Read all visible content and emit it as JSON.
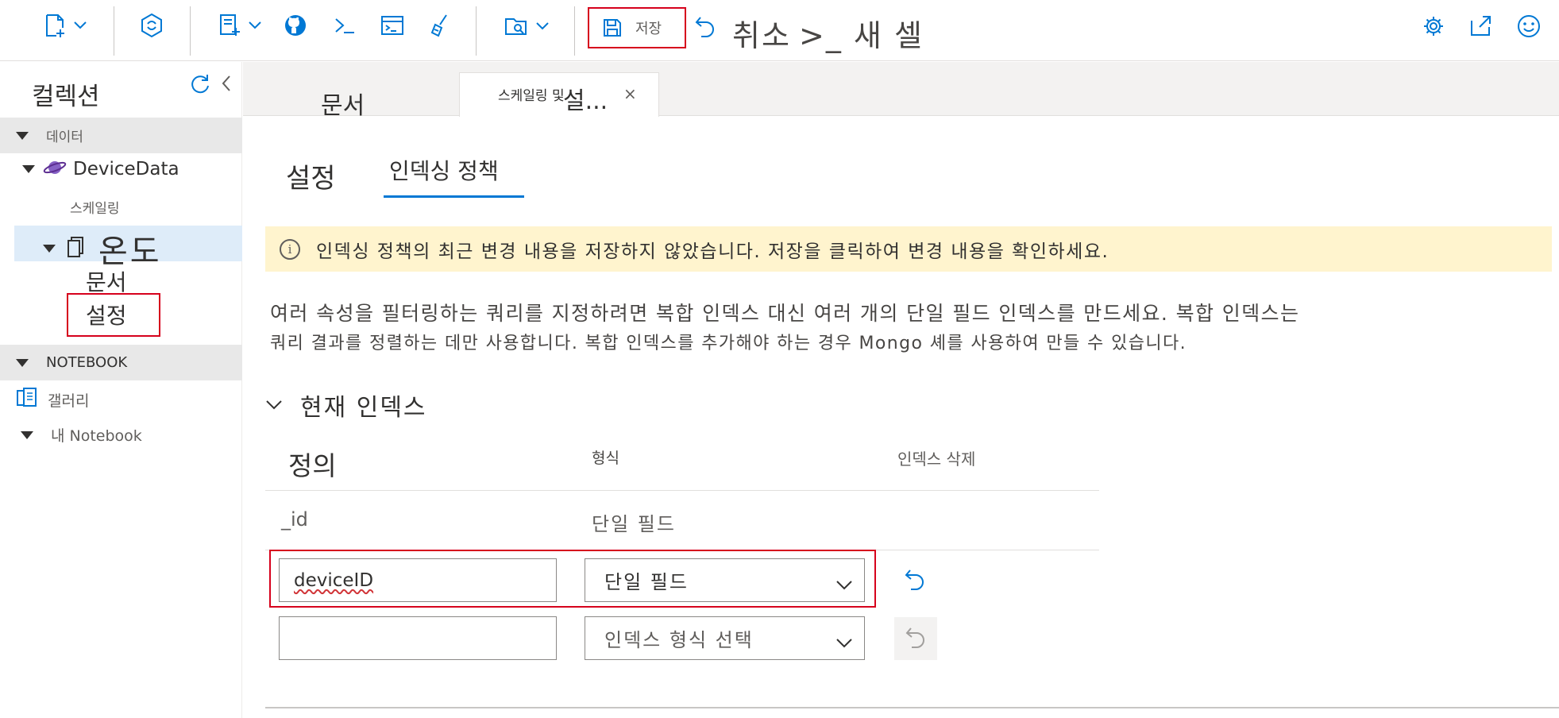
{
  "toolbar": {
    "save_label": "저장",
    "cancel_label": "취소",
    "new_cell_label": ">_ 새 셀"
  },
  "sidebar": {
    "title": "컬렉션",
    "data_section": "데이터",
    "database": "DeviceData",
    "scaling": "스케일링",
    "collection": "온도",
    "documents": "문서",
    "settings": "설정",
    "notebook_section": "NOTEBOOK",
    "gallery": "갤러리",
    "my_notebook": "내 Notebook"
  },
  "tabs": {
    "documents": "문서",
    "active_small": "스케일링 및",
    "active_big": "설...",
    "close": "×"
  },
  "subtabs": {
    "settings": "설정",
    "indexing_policy": "인덱싱 정책"
  },
  "banner": {
    "icon": "info-icon",
    "glyph": "i",
    "message": "인덱싱 정책의 최근 변경 내용을 저장하지 않았습니다. 저장을 클릭하여 변경 내용을 확인하세요."
  },
  "description": {
    "line1": "여러 속성을 필터링하는 쿼리를 지정하려면 복합 인덱스 대신 여러 개의 단일 필드 인덱스를 만드세요. 복합 인덱스는",
    "line2": "쿼리 결과를 정렬하는 데만 사용합니다. 복합 인덱스를 추가해야 하는 경우 Mongo 셰를 사용하여 만들 수 있습니다."
  },
  "indexes": {
    "section_title": "현재 인덱스",
    "col_definition": "정의",
    "col_type": "형식",
    "col_delete": "인덱스 삭제",
    "rows": [
      {
        "definition": "_id",
        "type": "단일 필드"
      }
    ],
    "edit_row": {
      "definition": "deviceID",
      "type": "단일 필드"
    },
    "new_row": {
      "definition": "",
      "type_placeholder": "인덱스 형식 선택"
    }
  },
  "colors": {
    "accent": "#0078d4",
    "highlight_red": "#d6001c",
    "banner_bg": "#fff4ce",
    "selected_bg": "#deecf9"
  }
}
